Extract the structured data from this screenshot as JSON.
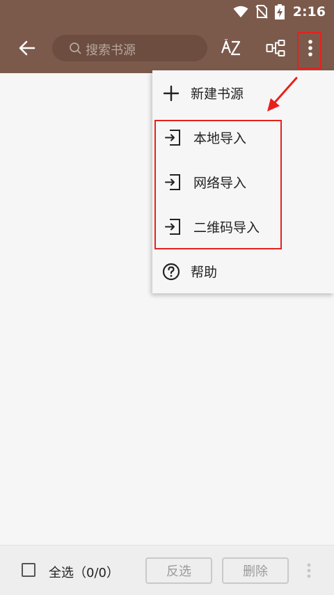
{
  "status_bar": {
    "time": "2:16",
    "icons": [
      "wifi-icon",
      "no-sim-icon",
      "battery-charging-icon"
    ]
  },
  "toolbar": {
    "back_icon": "arrow-left-icon",
    "search_placeholder": "搜索书源",
    "sort_icon": "sort-az-icon",
    "group_icon": "group-icon",
    "more_icon": "more-vert-icon"
  },
  "menu": {
    "items": [
      {
        "label": "新建书源",
        "icon": "plus-icon"
      },
      {
        "label": "本地导入",
        "icon": "import-icon"
      },
      {
        "label": "网络导入",
        "icon": "import-icon"
      },
      {
        "label": "二维码导入",
        "icon": "import-icon"
      },
      {
        "label": "帮助",
        "icon": "help-circle-icon"
      }
    ]
  },
  "bottom_bar": {
    "select_all_label": "全选（0/0）",
    "invert_label": "反选",
    "delete_label": "删除",
    "more_icon": "more-vert-icon"
  },
  "colors": {
    "toolbar": "#7b5a4c",
    "search_box": "#6c4d40",
    "annotation": "#e8201c",
    "background": "#f6f6f6"
  }
}
